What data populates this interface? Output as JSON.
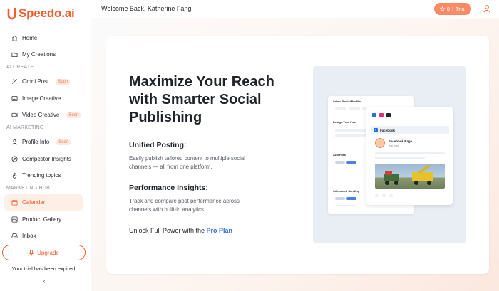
{
  "app": {
    "name": "Speedo.ai",
    "logo_letter": "U"
  },
  "sidebar": {
    "items_top": [
      {
        "label": "Home",
        "icon": "home-icon"
      },
      {
        "label": "My Creations",
        "icon": "folder-icon"
      }
    ],
    "sections": [
      {
        "title": "AI CREATE",
        "items": [
          {
            "label": "Omni Post",
            "icon": "omni-icon",
            "badge": "Soon"
          },
          {
            "label": "Image Creative",
            "icon": "image-icon",
            "badge": ""
          },
          {
            "label": "Video Creative",
            "icon": "video-icon",
            "badge": "Soon"
          }
        ]
      },
      {
        "title": "AI MARKETING",
        "items": [
          {
            "label": "Profile Info",
            "icon": "profile-icon",
            "badge": "Soon"
          },
          {
            "label": "Competitor Insights",
            "icon": "compass-icon",
            "badge": ""
          },
          {
            "label": "Trending topics",
            "icon": "flame-icon",
            "badge": ""
          }
        ]
      },
      {
        "title": "MARKETING HUB",
        "items": [
          {
            "label": "Calendar",
            "icon": "calendar-icon",
            "badge": "",
            "active": true
          },
          {
            "label": "Product Gallery",
            "icon": "gallery-icon",
            "badge": ""
          },
          {
            "label": "Inbox",
            "icon": "inbox-icon",
            "badge": ""
          }
        ]
      }
    ],
    "upgrade_label": "Upgrade",
    "trial_status": "Your trial has been expired",
    "collapse_glyph": "‹"
  },
  "topbar": {
    "welcome": "Welcome Back, Katherine Fang",
    "trial_count": "0",
    "trial_label": "Trial",
    "trial_sep": "|"
  },
  "hero": {
    "headline": "Maximize Your Reach with Smarter Social Publishing",
    "features": [
      {
        "title": "Unified Posting:",
        "text": "Easily publish tailored content to multiple social channels — all from one platform."
      },
      {
        "title": "Performance Insights:",
        "text": "Track and compare post performance across channels with built-in analytics."
      }
    ],
    "unlock_prefix": "Unlock Full Power with the ",
    "unlock_link": "Pro Plan"
  },
  "preview": {
    "select_profiles": "Select Social Profiles",
    "design_post": "Design Your Post",
    "add_files": "Add Files",
    "scheduled_sending": "Scheduled Sending",
    "facebook": "Facebook",
    "fb_page": "Facebook Page",
    "fb_time": "Just now"
  },
  "colors": {
    "brand": "#f45b2a",
    "link": "#2f6fe0",
    "trial_bg": "#f98a63"
  }
}
